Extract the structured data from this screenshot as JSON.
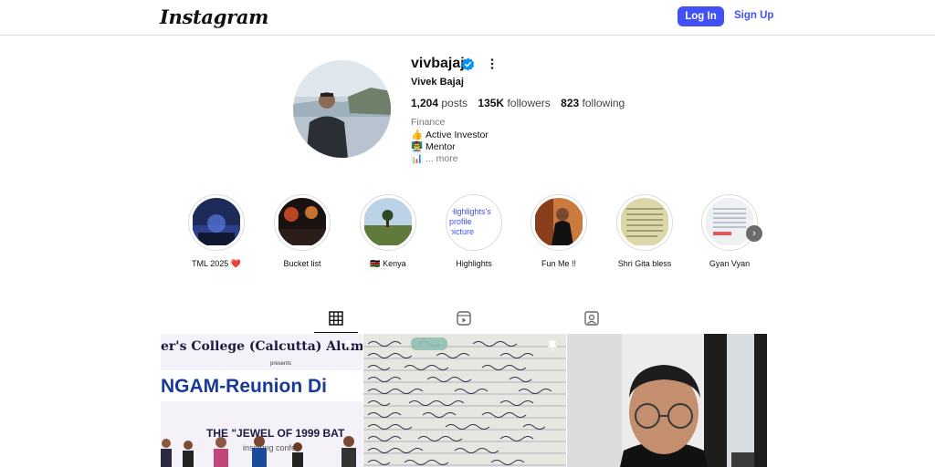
{
  "header": {
    "logo_text": "Instagram",
    "login_label": "Log In",
    "signup_label": "Sign Up"
  },
  "profile": {
    "username": "vivbajaj",
    "full_name": "Vivek Bajaj",
    "posts_count": "1,204",
    "posts_label": "posts",
    "followers_count": "135K",
    "followers_label": "followers",
    "following_count": "823",
    "following_label": "following",
    "category": "Finance",
    "bio": [
      {
        "emoji": "👍",
        "text": "Active Investor"
      },
      {
        "emoji": "👨‍🏫",
        "text": "Mentor"
      },
      {
        "emoji": "📊",
        "text": "... more"
      }
    ]
  },
  "highlights": [
    {
      "label": "TML 2025 ❤️"
    },
    {
      "label": "Bucket list"
    },
    {
      "label": "🇰🇪 Kenya"
    },
    {
      "label": "Highlights",
      "image_alt": "Highlights's profile picture"
    },
    {
      "label": "Fun Me !!"
    },
    {
      "label": "Shri Gita bless"
    },
    {
      "label": "Gyan Vyan"
    }
  ],
  "tabs": [
    {
      "icon": "grid-icon"
    },
    {
      "icon": "reels-icon"
    },
    {
      "icon": "tagged-icon"
    }
  ],
  "posts": [
    {
      "banner_top": "er's College (Calcutta) Alumni As",
      "banner_small": "presents",
      "banner_main": "NGAM-Reunion Di",
      "banner_sub": "THE \"JEWEL OF 1999 BAT",
      "banner_sub2": "inspiring confe"
    },
    {
      "type": "handwritten-notes"
    },
    {
      "type": "video-portrait"
    }
  ],
  "colors": {
    "accent": "#4150f7",
    "verified": "#0095f6",
    "divider": "#dbdbdb",
    "heart": "#e0245e"
  }
}
